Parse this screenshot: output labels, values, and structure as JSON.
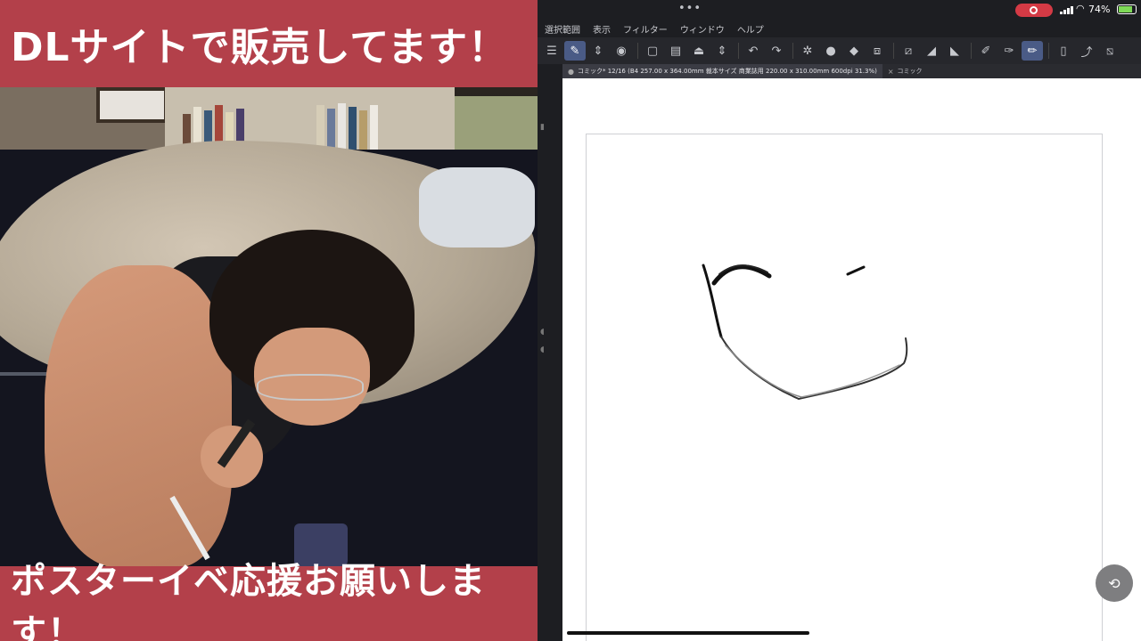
{
  "overlay": {
    "top_banner": "DLサイトで販売してます！",
    "bottom_banner": "ポスターイベ応援お願いします！",
    "banner_color": "#b3404a"
  },
  "app": {
    "status": {
      "battery": "74%",
      "recording_icon": "record-icon",
      "wifi_icon": "wifi-icon"
    },
    "menu": [
      "選択範囲",
      "表示",
      "フィルター",
      "ウィンドウ",
      "ヘルプ"
    ],
    "toolbar": {
      "icons": [
        "menu-icon",
        "edit-icon",
        "split-icon",
        "eye-icon",
        "new-icon",
        "open-icon",
        "save-icon",
        "updown-icon",
        "undo-icon",
        "redo-icon",
        "settings-icon",
        "circle-icon",
        "fill-icon",
        "transform-icon",
        "layer-icon",
        "ruler-icon",
        "pen-icon",
        "brush-icon",
        "pencil-icon",
        "phone-icon",
        "export-icon",
        "crop-icon"
      ]
    },
    "tabs": [
      {
        "label": "コミック* 12/16 (B4 257.00 x 364.00mm 裁本サイズ 商業誌用 220.00 x 310.00mm 600dpi 31.3%)",
        "active": true
      },
      {
        "label": "コミック",
        "active": false
      }
    ],
    "canvas": {
      "rotate_icon": "rotate-icon"
    }
  }
}
